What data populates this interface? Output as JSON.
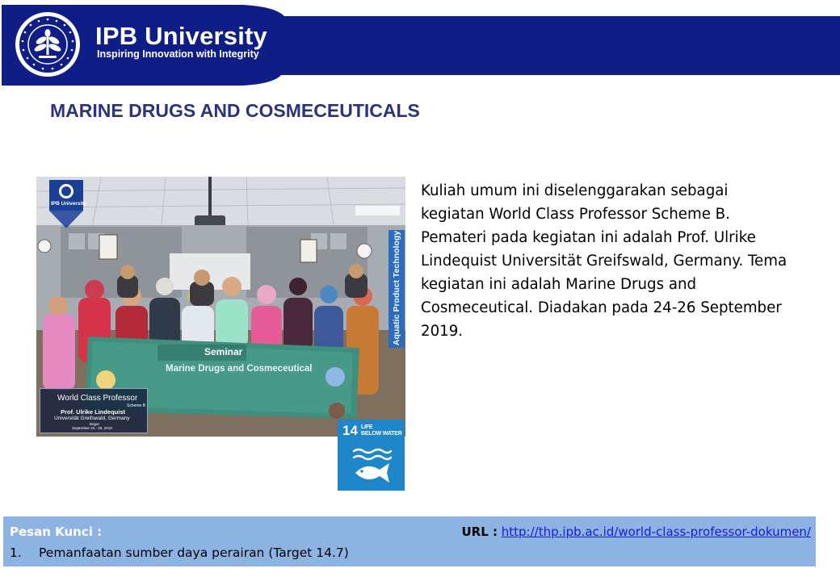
{
  "header": {
    "brand_name": "IPB University",
    "tagline": "Inspiring Innovation with Integrity",
    "logo_icon": "ipb-seal-icon",
    "banner_color": "#0f1d86"
  },
  "title": "MARINE DRUGS AND COSMECEUTICALS",
  "photo": {
    "corner_logo_label": "IPB University",
    "side_banner": "Aquatic Product Technology",
    "banner_heading": "Seminar",
    "banner_topic": "Marine Drugs and Cosmeceutical",
    "overlay": {
      "title": "World Class Professor",
      "scheme": "Scheme B",
      "name": "Prof. Ulrike Lindequist",
      "university": "Universität Greifswald, Germany",
      "place": "Bogor",
      "date": "September 24 - 26, 2019"
    }
  },
  "sdg": {
    "number": "14",
    "line1": "LIFE",
    "line2": "BELOW WATER",
    "color": "#1f86c9",
    "icon": "fish-waves-icon"
  },
  "description": {
    "lines": [
      "Kuliah umum ini diselenggarakan sebagai",
      "kegiatan World Class Professor Scheme B.",
      "Pemateri pada kegiatan ini adalah Prof. Ulrike",
      "Lindequist Universität Greifswald, Germany. Tema",
      "kegiatan ini adalah Marine Drugs and",
      "Cosmeceutical. Diadakan pada 24-26 September",
      "2019."
    ]
  },
  "footer": {
    "key_heading": "Pesan Kunci :",
    "key_items": [
      {
        "number": "1.",
        "text": "Pemanfaatan sumber daya perairan (Target 14.7)"
      }
    ],
    "url_label": "URL :",
    "url": "http://thp.ipb.ac.id/world-class-professor-dokumen/",
    "background_color": "#8db3e2"
  }
}
